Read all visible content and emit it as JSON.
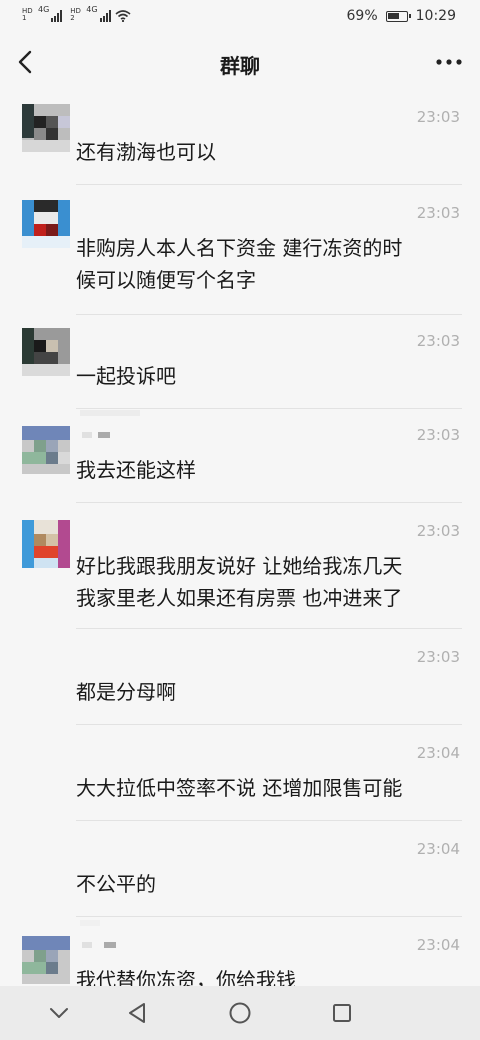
{
  "status_bar": {
    "hd1": "HD 1",
    "hd2": "HD 2",
    "net1": "4G",
    "net2": "4G",
    "battery_percent_text": "69%",
    "battery_level": 0.69,
    "time": "10:29"
  },
  "header": {
    "title": "群聊",
    "back_icon": "chevron-left-icon",
    "more_icon": "more-horizontal-icon"
  },
  "messages": [
    {
      "time": "23:03",
      "text": "还有渤海也可以"
    },
    {
      "time": "23:03",
      "text": "非购房人本人名下资金 建行冻资的时\n候可以随便写个名字"
    },
    {
      "time": "23:03",
      "text": "一起投诉吧"
    },
    {
      "time": "23:03",
      "text": "我去还能这样"
    },
    {
      "time": "23:03",
      "text": "好比我跟我朋友说好 让她给我冻几天\n我家里老人如果还有房票 也冲进来了"
    },
    {
      "time": "23:03",
      "text": "都是分母啊"
    },
    {
      "time": "23:04",
      "text": "大大拉低中签率不说 还增加限售可能"
    },
    {
      "time": "23:04",
      "text": "不公平的"
    },
    {
      "time": "23:04",
      "text": "我代替你冻资，你给我钱"
    }
  ],
  "system_nav": {
    "icons": [
      "chevron-down-icon",
      "back-triangle-icon",
      "home-circle-icon",
      "recents-square-icon"
    ]
  },
  "colors": {
    "background": "#f6f6f6",
    "timestamp": "#b0b0b0",
    "divider": "#e2e2e2",
    "nav_bar": "#ebebeb"
  }
}
